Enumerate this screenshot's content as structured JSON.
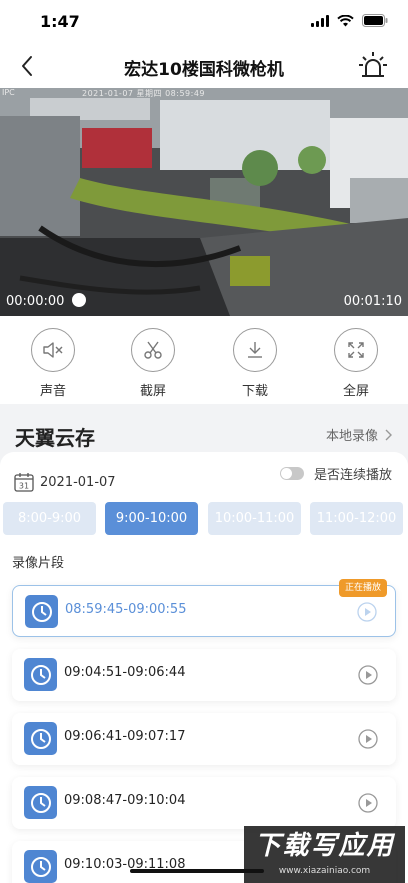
{
  "status_bar": {
    "time": "1:47"
  },
  "nav": {
    "title": "宏达10楼国科微枪机"
  },
  "video": {
    "osd_left": "IPC",
    "osd_center": "2021-01-07 星期四 08:59:49",
    "current_time": "00:00:00",
    "total_time": "00:01:10",
    "progress": 0
  },
  "controls": [
    {
      "label": "声音",
      "icon": "mute-icon"
    },
    {
      "label": "截屏",
      "icon": "scissors-icon"
    },
    {
      "label": "下载",
      "icon": "download-icon"
    },
    {
      "label": "全屏",
      "icon": "fullscreen-icon"
    }
  ],
  "cloud": {
    "title": "天翼云存",
    "local_label": "本地录像"
  },
  "panel": {
    "date": "2021-01-07",
    "calendar_day": "31",
    "continuous_label": "是否连续播放",
    "continuous_on": false,
    "slots": [
      {
        "label": "8:00-9:00",
        "active": false
      },
      {
        "label": "9:00-10:00",
        "active": true
      },
      {
        "label": "10:00-11:00",
        "active": false
      },
      {
        "label": "11:00-12:00",
        "active": false
      }
    ],
    "segments_title": "录像片段",
    "playing_badge": "正在播放",
    "records": [
      {
        "time": "08:59:45-09:00:55",
        "playing": true
      },
      {
        "time": "09:04:51-09:06:44",
        "playing": false
      },
      {
        "time": "09:06:41-09:07:17",
        "playing": false
      },
      {
        "time": "09:08:47-09:10:04",
        "playing": false
      },
      {
        "time": "09:10:03-09:11:08",
        "playing": false
      }
    ]
  },
  "watermark": {
    "main": "下载写应用",
    "url": "www.xiazainiao.com"
  }
}
